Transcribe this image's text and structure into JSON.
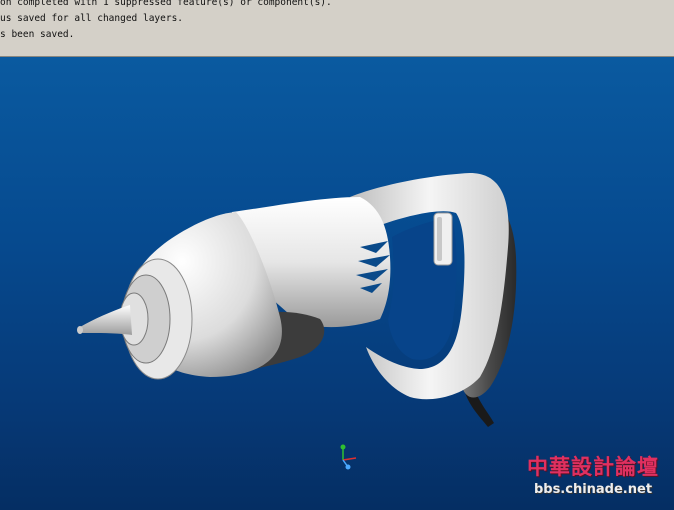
{
  "message_area": {
    "lines": [
      "on completed with 1 suppressed feature(s) or component(s).",
      "us saved for all changed layers.",
      "s been saved."
    ]
  },
  "watermark": {
    "chinese_text": "中華設計論壇",
    "url": "bbs.chinade.net"
  },
  "colors": {
    "message_bg": "#d4d0c8",
    "viewport_top": "#0a5aa0",
    "viewport_bottom": "#052e63",
    "model_light": "#f2f2f2",
    "model_dark": "#3c3c3c",
    "watermark_red": "#e03060"
  },
  "triad": {
    "x_axis_color": "#e03030",
    "y_axis_color": "#30c030",
    "z_axis_color": "#4aa8ff"
  }
}
